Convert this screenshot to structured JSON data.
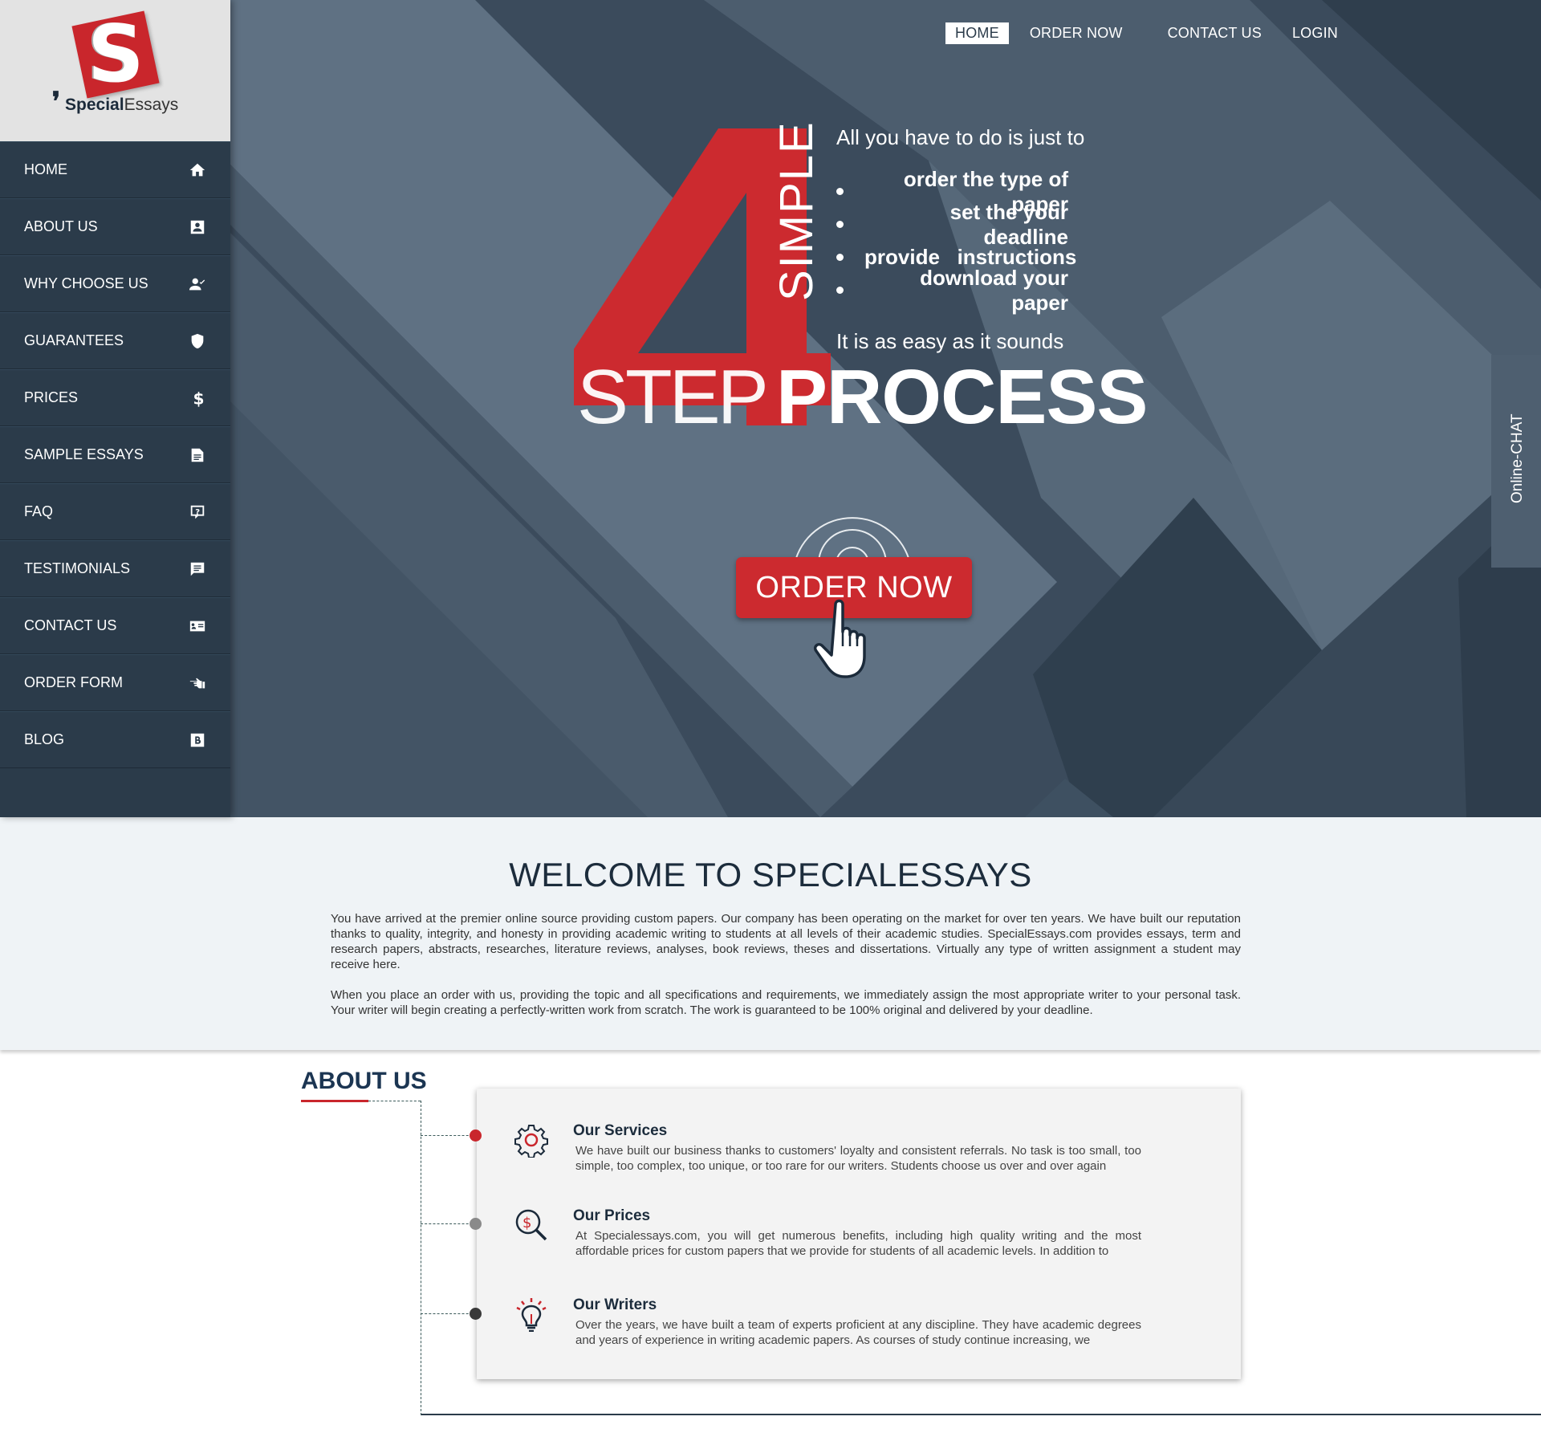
{
  "logo": {
    "letter": "S",
    "brand_bold": "Special",
    "brand_light": "Essays"
  },
  "sidebar": {
    "items": [
      {
        "label": "HOME",
        "icon": "home-icon"
      },
      {
        "label": "ABOUT US",
        "icon": "contact-card-icon"
      },
      {
        "label": "WHY CHOOSE US",
        "icon": "user-check-icon"
      },
      {
        "label": "GUARANTEES",
        "icon": "shield-icon"
      },
      {
        "label": "PRICES",
        "icon": "dollar-icon"
      },
      {
        "label": "SAMPLE ESSAYS",
        "icon": "document-icon"
      },
      {
        "label": "FAQ",
        "icon": "question-icon"
      },
      {
        "label": "TESTIMONIALS",
        "icon": "comment-icon"
      },
      {
        "label": "CONTACT US",
        "icon": "id-card-icon"
      },
      {
        "label": "ORDER FORM",
        "icon": "pointing-hand-icon"
      },
      {
        "label": "BLOG",
        "icon": "blog-icon"
      }
    ]
  },
  "topnav": {
    "home": "HOME",
    "order": "ORDER NOW",
    "contact": "CONTACT US",
    "login": "LOGIN"
  },
  "hero": {
    "number": "4",
    "simple": "SIMPLE",
    "step": "STEP",
    "process": "PROCESS",
    "intro": "All you have to do is just to",
    "steps": [
      "order the type of paper",
      "set the your deadline",
      "provide   instructions",
      "download your paper"
    ],
    "easy": "It is as easy as it sounds",
    "cta": "ORDER NOW"
  },
  "chat": {
    "label": "Online-CHAT"
  },
  "welcome": {
    "title": "WELCOME TO SPECIALESSAYS",
    "p1": "You have arrived at the premier online source providing custom papers. Our company has been operating on the market for over ten years. We have built our reputation thanks to quality, integrity, and honesty in providing academic writing to students at all levels of their academic studies. SpecialEssays.com provides essays, term and research papers, abstracts, researches, literature reviews, analyses, book reviews, theses and dissertations. Virtually any type of written assignment a student may receive here.",
    "p2": "When you place an order with us, providing the topic and all specifications and requirements, we immediately assign the most appropriate writer to your personal task. Your writer will begin creating a perfectly-written work from scratch. The work is guaranteed to be 100% original and delivered by your deadline."
  },
  "about": {
    "title": "ABOUT US",
    "items": [
      {
        "title": "Our Services",
        "icon": "gear-icon",
        "dot_color": "#c9262c",
        "text": "We have built our business thanks to customers' loyalty and consistent referrals. No task is too small, too simple, too complex, too unique, or too rare for our writers. Students choose us over and over again"
      },
      {
        "title": "Our Prices",
        "icon": "magnifier-dollar-icon",
        "dot_color": "#8a8a8a",
        "text": "At Specialessays.com, you will get numerous benefits, including high quality writing and the most affordable prices for custom papers that we provide for students of all academic levels. In addition to"
      },
      {
        "title": "Our Writers",
        "icon": "lightbulb-icon",
        "dot_color": "#3a3a3a",
        "text": "Over the years, we have built a team of experts proficient at any discipline. They have academic degrees and years of experience in writing academic papers. As courses of study continue increasing, we"
      }
    ]
  },
  "colors": {
    "accent": "#c9262c",
    "sidebar": "#2b3b4a",
    "hero": "#3b4b5c"
  }
}
